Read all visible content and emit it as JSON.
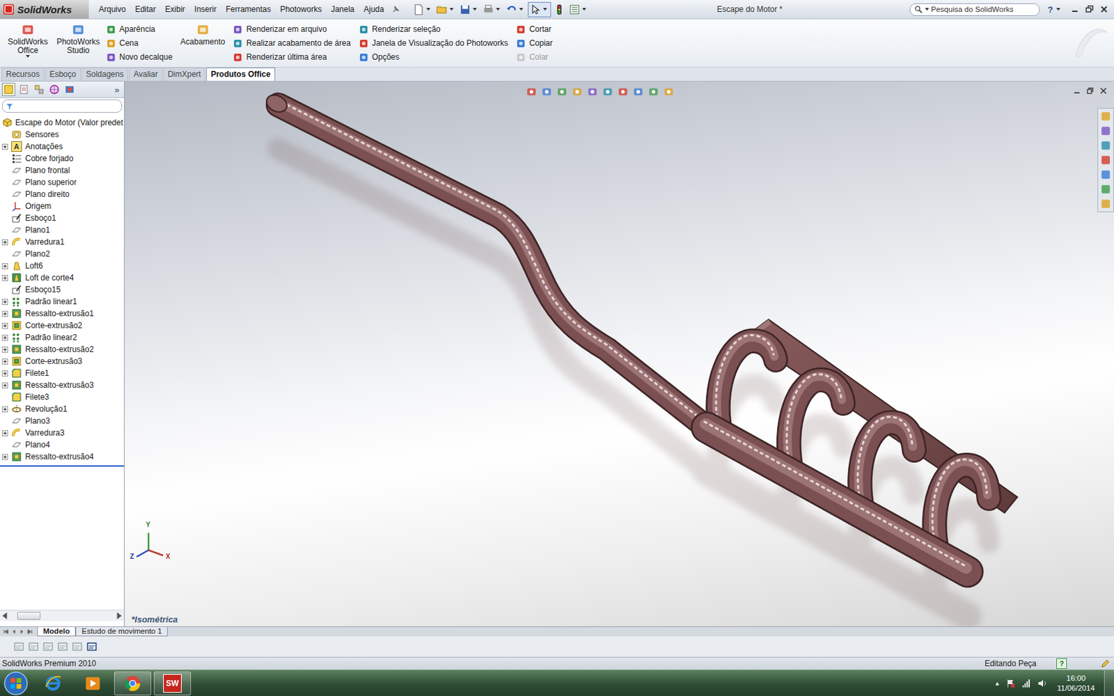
{
  "app": {
    "name": "SolidWorks"
  },
  "menu": [
    "Arquivo",
    "Editar",
    "Exibir",
    "Inserir",
    "Ferramentas",
    "Photoworks",
    "Janela",
    "Ajuda"
  ],
  "window": {
    "title": "Escape do Motor *"
  },
  "search": {
    "placeholder": "Pesquisa do SolidWorks"
  },
  "help": "?",
  "ribbon": [
    {
      "kind": "big",
      "items": [
        {
          "label": "SolidWorks Office",
          "disabled": false,
          "dropdown": true
        }
      ]
    },
    {
      "kind": "big",
      "items": [
        {
          "label": "PhotoWorks Studio",
          "disabled": false,
          "dropdown": false
        }
      ]
    },
    {
      "kind": "column",
      "items": [
        {
          "label": "Aparência",
          "disabled": false,
          "dropdown": false
        },
        {
          "label": "Cena",
          "disabled": false,
          "dropdown": false
        },
        {
          "label": "Novo decalque",
          "disabled": false,
          "dropdown": false
        }
      ]
    },
    {
      "kind": "big",
      "items": [
        {
          "label": "Acabamento",
          "disabled": false,
          "dropdown": false
        }
      ]
    },
    {
      "kind": "column",
      "items": [
        {
          "label": "Renderizar em arquivo",
          "disabled": false,
          "dropdown": false
        },
        {
          "label": "Realizar acabamento de área",
          "disabled": false,
          "dropdown": false
        },
        {
          "label": "Renderizar última área",
          "disabled": false,
          "dropdown": false
        }
      ]
    },
    {
      "kind": "column",
      "items": [
        {
          "label": "Renderizar seleção",
          "disabled": false,
          "dropdown": false
        },
        {
          "label": "Janela de Visualização do Photoworks",
          "disabled": false,
          "dropdown": false
        },
        {
          "label": "Opções",
          "disabled": false,
          "dropdown": false
        }
      ]
    },
    {
      "kind": "column",
      "items": [
        {
          "label": "Cortar",
          "disabled": false,
          "dropdown": false
        },
        {
          "label": "Copiar",
          "disabled": false,
          "dropdown": false
        },
        {
          "label": "Colar",
          "disabled": true,
          "dropdown": false
        }
      ]
    }
  ],
  "command_tabs": [
    {
      "label": "Recursos",
      "selected": false
    },
    {
      "label": "Esboço",
      "selected": false
    },
    {
      "label": "Soldagens",
      "selected": false
    },
    {
      "label": "Avaliar",
      "selected": false
    },
    {
      "label": "DimXpert",
      "selected": false
    },
    {
      "label": "Produtos Office",
      "selected": true
    }
  ],
  "feature_tree": {
    "more": "»",
    "root": {
      "label": "Escape do Motor  (Valor predet"
    },
    "items": [
      {
        "label": "Sensores",
        "kind": "sensor",
        "expandable": false,
        "expanded": false
      },
      {
        "label": "Anotações",
        "kind": "annotation",
        "glyph": "A",
        "expandable": true,
        "expanded": false
      },
      {
        "label": "Cobre forjado",
        "kind": "material",
        "expandable": false,
        "expanded": false
      },
      {
        "label": "Plano frontal",
        "kind": "plane",
        "expandable": false,
        "expanded": false
      },
      {
        "label": "Plano superior",
        "kind": "plane",
        "expandable": false,
        "expanded": false
      },
      {
        "label": "Plano direito",
        "kind": "plane",
        "expandable": false,
        "expanded": false
      },
      {
        "label": "Origem",
        "kind": "origin",
        "expandable": false,
        "expanded": false
      },
      {
        "label": "Esboço1",
        "kind": "sketch",
        "expandable": false,
        "expanded": false
      },
      {
        "label": "Plano1",
        "kind": "plane",
        "expandable": false,
        "expanded": false
      },
      {
        "label": "Varredura1",
        "kind": "sweep",
        "expandable": true,
        "expanded": false
      },
      {
        "label": "Plano2",
        "kind": "plane",
        "expandable": false,
        "expanded": false
      },
      {
        "label": "Loft6",
        "kind": "loft",
        "expandable": true,
        "expanded": false
      },
      {
        "label": "Loft de corte4",
        "kind": "cut_loft",
        "expandable": true,
        "expanded": false
      },
      {
        "label": "Esboço15",
        "kind": "sketch",
        "expandable": false,
        "expanded": false
      },
      {
        "label": "Padrão linear1",
        "kind": "pattern",
        "expandable": true,
        "expanded": false
      },
      {
        "label": "Ressalto-extrusão1",
        "kind": "boss",
        "expandable": true,
        "expanded": false
      },
      {
        "label": "Corte-extrusão2",
        "kind": "cut",
        "expandable": true,
        "expanded": false
      },
      {
        "label": "Padrão linear2",
        "kind": "pattern",
        "expandable": true,
        "expanded": false
      },
      {
        "label": "Ressalto-extrusão2",
        "kind": "boss",
        "expandable": true,
        "expanded": false
      },
      {
        "label": "Corte-extrusão3",
        "kind": "cut",
        "expandable": true,
        "expanded": false
      },
      {
        "label": "Filete1",
        "kind": "fillet",
        "expandable": true,
        "expanded": false
      },
      {
        "label": "Ressalto-extrusão3",
        "kind": "boss",
        "expandable": true,
        "expanded": false
      },
      {
        "label": "Filete3",
        "kind": "fillet",
        "expandable": false,
        "expanded": false
      },
      {
        "label": "Revolução1",
        "kind": "revolve",
        "expandable": true,
        "expanded": false
      },
      {
        "label": "Plano3",
        "kind": "plane",
        "expandable": false,
        "expanded": false
      },
      {
        "label": "Varredura3",
        "kind": "sweep",
        "expandable": true,
        "expanded": false
      },
      {
        "label": "Plano4",
        "kind": "plane",
        "expandable": false,
        "expanded": false
      },
      {
        "label": "Ressalto-extrusão4",
        "kind": "boss",
        "expandable": true,
        "expanded": false
      }
    ],
    "h_scrollbar": {
      "level": 0.22
    }
  },
  "viewport": {
    "view_label": "*Isométrica",
    "triad": {
      "x": "X",
      "y": "Y",
      "z": "Z"
    }
  },
  "bottom_tabs": [
    {
      "label": "Modelo",
      "selected": true
    },
    {
      "label": "Estudo de movimento 1",
      "selected": false
    }
  ],
  "status_bar": {
    "product": "SolidWorks Premium 2010",
    "mode": "Editando Peça",
    "help": "?"
  },
  "taskbar": {
    "apps": [
      {
        "kind": "ie",
        "running": false
      },
      {
        "kind": "media",
        "running": false
      },
      {
        "kind": "chrome",
        "running": true
      },
      {
        "kind": "solidworks",
        "running": true,
        "label": "SW"
      }
    ]
  },
  "tray": {
    "show_hidden": "▲",
    "time": "16:00",
    "date": "11/06/2014"
  }
}
